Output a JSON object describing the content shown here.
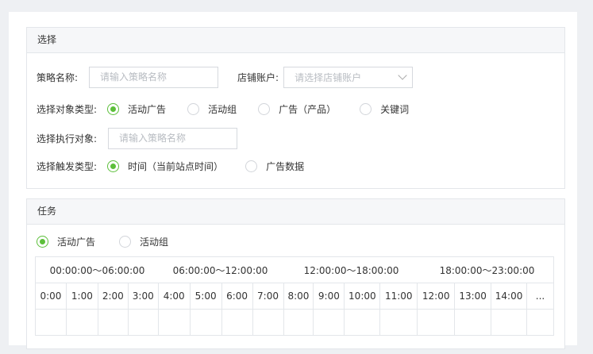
{
  "select_panel": {
    "title": "选择",
    "strategy_label": "策略名称:",
    "strategy_placeholder": "请输入策略名称",
    "store_label": "店铺账户:",
    "store_placeholder": "请选择店铺账户",
    "object_type_label": "选择对象类型:",
    "object_types": [
      "活动广告",
      "活动组",
      "广告（产品）",
      "关键词"
    ],
    "object_selected": 0,
    "exec_object_label": "选择执行对象:",
    "exec_object_placeholder": "请输入策略名称",
    "trigger_label": "选择触发类型:",
    "trigger_types": [
      "时间（当前站点时间）",
      "广告数据"
    ],
    "trigger_selected": 0
  },
  "task_panel": {
    "title": "任务",
    "options": [
      "活动广告",
      "活动组"
    ],
    "selected": 0,
    "ranges": [
      "00:00:00～06:00:00",
      "06:00:00～12:00:00",
      "12:00:00～18:00:00",
      "18:00:00～23:00:00"
    ],
    "hours": [
      "0:00",
      "1:00",
      "2:00",
      "3:00",
      "4:00",
      "5:00",
      "6:00",
      "7:00",
      "8:00",
      "9:00",
      "10:00",
      "11:00",
      "12:00",
      "13:00",
      "14:00",
      "..."
    ]
  },
  "colors": {
    "accent": "#5cbf3a",
    "background": "#eef0f3"
  }
}
